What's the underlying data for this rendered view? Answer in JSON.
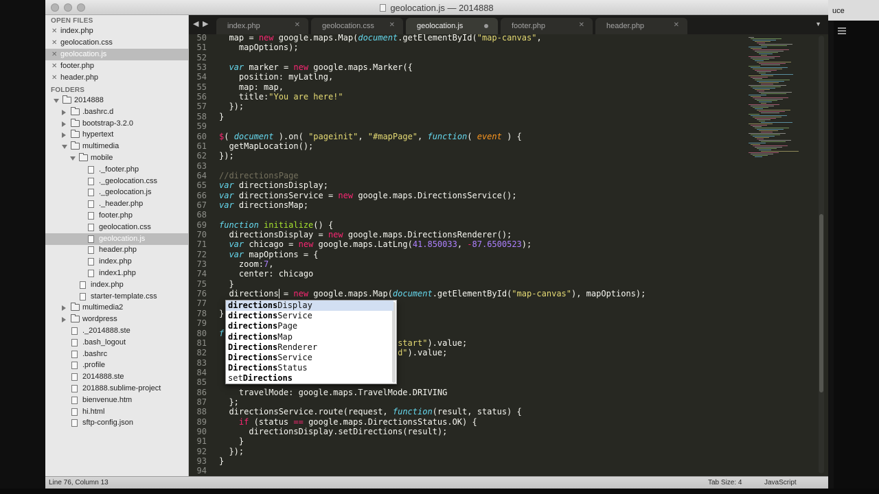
{
  "window": {
    "title": "geolocation.js — 2014888"
  },
  "backdrop": {
    "peek_text": "uce"
  },
  "sidebar": {
    "open_files_header": "OPEN FILES",
    "open_files": [
      {
        "name": "index.php",
        "selected": false
      },
      {
        "name": "geolocation.css",
        "selected": false
      },
      {
        "name": "geolocation.js",
        "selected": true
      },
      {
        "name": "footer.php",
        "selected": false
      },
      {
        "name": "header.php",
        "selected": false
      }
    ],
    "folders_header": "FOLDERS",
    "tree": [
      {
        "name": "2014888",
        "type": "folder",
        "expanded": true,
        "depth": 0
      },
      {
        "name": ".bashrc.d",
        "type": "folder",
        "expanded": false,
        "depth": 1
      },
      {
        "name": "bootstrap-3.2.0",
        "type": "folder",
        "expanded": false,
        "depth": 1
      },
      {
        "name": "hypertext",
        "type": "folder",
        "expanded": false,
        "depth": 1
      },
      {
        "name": "multimedia",
        "type": "folder",
        "expanded": true,
        "depth": 1
      },
      {
        "name": "mobile",
        "type": "folder",
        "expanded": true,
        "depth": 2
      },
      {
        "name": "._footer.php",
        "type": "file",
        "depth": 3
      },
      {
        "name": "._geolocation.css",
        "type": "file",
        "depth": 3
      },
      {
        "name": "._geolocation.js",
        "type": "file",
        "depth": 3
      },
      {
        "name": "._header.php",
        "type": "file",
        "depth": 3
      },
      {
        "name": "footer.php",
        "type": "file",
        "depth": 3
      },
      {
        "name": "geolocation.css",
        "type": "file",
        "depth": 3
      },
      {
        "name": "geolocation.js",
        "type": "file",
        "depth": 3,
        "selected": true
      },
      {
        "name": "header.php",
        "type": "file",
        "depth": 3
      },
      {
        "name": "index.php",
        "type": "file",
        "depth": 3
      },
      {
        "name": "index1.php",
        "type": "file",
        "depth": 3
      },
      {
        "name": "index.php",
        "type": "file",
        "depth": 2
      },
      {
        "name": "starter-template.css",
        "type": "file",
        "depth": 2
      },
      {
        "name": "multimedia2",
        "type": "folder",
        "expanded": false,
        "depth": 1
      },
      {
        "name": "wordpress",
        "type": "folder",
        "expanded": false,
        "depth": 1
      },
      {
        "name": "._2014888.ste",
        "type": "file",
        "depth": 1
      },
      {
        "name": ".bash_logout",
        "type": "file",
        "depth": 1
      },
      {
        "name": ".bashrc",
        "type": "file",
        "depth": 1
      },
      {
        "name": ".profile",
        "type": "file",
        "depth": 1
      },
      {
        "name": "2014888.ste",
        "type": "file",
        "depth": 1
      },
      {
        "name": "201888.sublime-project",
        "type": "file",
        "depth": 1
      },
      {
        "name": "bienvenue.htm",
        "type": "file",
        "depth": 1
      },
      {
        "name": "hi.html",
        "type": "file",
        "depth": 1
      },
      {
        "name": "sftp-config.json",
        "type": "file",
        "depth": 1
      }
    ]
  },
  "tabs": {
    "nav_left": "◀",
    "nav_right": "▶",
    "more": "▼",
    "items": [
      {
        "label": "index.php",
        "active": false,
        "dirty": false
      },
      {
        "label": "geolocation.css",
        "active": false,
        "dirty": false
      },
      {
        "label": "geolocation.js",
        "active": true,
        "dirty": true
      },
      {
        "label": "footer.php",
        "active": false,
        "dirty": false
      },
      {
        "label": "header.php",
        "active": false,
        "dirty": false
      }
    ],
    "close_glyph": "✕"
  },
  "editor": {
    "lines": [
      {
        "n": "50",
        "tokens": [
          [
            "  ",
            ""
          ],
          [
            "map",
            "cl"
          ],
          [
            " = ",
            ""
          ],
          [
            "new",
            "op"
          ],
          [
            " google.maps.Map(",
            ""
          ],
          [
            "document",
            "kw"
          ],
          [
            ".getElementById(",
            ""
          ],
          [
            "\"map-canvas\"",
            "st"
          ],
          [
            ",",
            ""
          ]
        ]
      },
      {
        "n": "51",
        "tokens": [
          [
            "    mapOptions);",
            ""
          ]
        ]
      },
      {
        "n": "52",
        "tokens": []
      },
      {
        "n": "53",
        "tokens": [
          [
            "  ",
            ""
          ],
          [
            "var",
            "kw"
          ],
          [
            " marker = ",
            ""
          ],
          [
            "new",
            "op"
          ],
          [
            " google.maps.Marker({",
            ""
          ]
        ]
      },
      {
        "n": "54",
        "tokens": [
          [
            "    position: myLatlng,",
            ""
          ]
        ]
      },
      {
        "n": "55",
        "tokens": [
          [
            "    map: map,",
            ""
          ]
        ]
      },
      {
        "n": "56",
        "tokens": [
          [
            "    title:",
            ""
          ],
          [
            "\"You are here!\"",
            "st"
          ]
        ]
      },
      {
        "n": "57",
        "tokens": [
          [
            "  });",
            ""
          ]
        ]
      },
      {
        "n": "58",
        "tokens": [
          [
            "}",
            ""
          ]
        ]
      },
      {
        "n": "59",
        "tokens": []
      },
      {
        "n": "60",
        "tokens": [
          [
            "$",
            "op"
          ],
          [
            "( ",
            ""
          ],
          [
            "document",
            "kw"
          ],
          [
            " ).on( ",
            ""
          ],
          [
            "\"pageinit\"",
            "st"
          ],
          [
            ", ",
            ""
          ],
          [
            "\"#mapPage\"",
            "st"
          ],
          [
            ", ",
            ""
          ],
          [
            "function",
            "kw"
          ],
          [
            "( ",
            ""
          ],
          [
            "event",
            "pa"
          ],
          [
            " ) {",
            ""
          ]
        ]
      },
      {
        "n": "61",
        "tokens": [
          [
            "  getMapLocation();",
            ""
          ]
        ]
      },
      {
        "n": "62",
        "tokens": [
          [
            "});",
            ""
          ]
        ]
      },
      {
        "n": "63",
        "tokens": []
      },
      {
        "n": "64",
        "tokens": [
          [
            "//directionsPage",
            "cm"
          ]
        ]
      },
      {
        "n": "65",
        "tokens": [
          [
            "var",
            "kw"
          ],
          [
            " directionsDisplay;",
            ""
          ]
        ]
      },
      {
        "n": "66",
        "tokens": [
          [
            "var",
            "kw"
          ],
          [
            " directionsService = ",
            ""
          ],
          [
            "new",
            "op"
          ],
          [
            " google.maps.DirectionsService();",
            ""
          ]
        ]
      },
      {
        "n": "67",
        "tokens": [
          [
            "var",
            "kw"
          ],
          [
            " directionsMap;",
            ""
          ]
        ]
      },
      {
        "n": "68",
        "tokens": []
      },
      {
        "n": "69",
        "tokens": [
          [
            "function",
            "kw"
          ],
          [
            " ",
            ""
          ],
          [
            "initialize",
            "fn"
          ],
          [
            "() {",
            ""
          ]
        ]
      },
      {
        "n": "70",
        "tokens": [
          [
            "  directionsDisplay = ",
            ""
          ],
          [
            "new",
            "op"
          ],
          [
            " google.maps.DirectionsRenderer();",
            ""
          ]
        ]
      },
      {
        "n": "71",
        "tokens": [
          [
            "  ",
            ""
          ],
          [
            "var",
            "kw"
          ],
          [
            " chicago = ",
            ""
          ],
          [
            "new",
            "op"
          ],
          [
            " google.maps.LatLng(",
            ""
          ],
          [
            "41.850033",
            "nu"
          ],
          [
            ", ",
            ""
          ],
          [
            "-",
            "op"
          ],
          [
            "87.6500523",
            "nu"
          ],
          [
            ");",
            ""
          ]
        ]
      },
      {
        "n": "72",
        "tokens": [
          [
            "  ",
            ""
          ],
          [
            "var",
            "kw"
          ],
          [
            " mapOptions = {",
            ""
          ]
        ]
      },
      {
        "n": "73",
        "tokens": [
          [
            "    zoom:",
            ""
          ],
          [
            "7",
            "nu"
          ],
          [
            ",",
            ""
          ]
        ]
      },
      {
        "n": "74",
        "tokens": [
          [
            "    center: chicago",
            ""
          ]
        ]
      },
      {
        "n": "75",
        "tokens": [
          [
            "  }",
            ""
          ]
        ]
      },
      {
        "n": "76",
        "tokens": [
          [
            "  directions",
            ""
          ],
          [
            " = ",
            ""
          ],
          [
            "new",
            "op"
          ],
          [
            " google.maps.Map(",
            ""
          ],
          [
            "document",
            "kw"
          ],
          [
            ".getElementById(",
            ""
          ],
          [
            "\"map-canvas\"",
            "st"
          ],
          [
            "), mapOptions);",
            ""
          ]
        ]
      },
      {
        "n": "77",
        "tokens": []
      },
      {
        "n": "78",
        "tokens": [
          [
            "}",
            ""
          ]
        ]
      },
      {
        "n": "79",
        "tokens": []
      },
      {
        "n": "80",
        "tokens": [
          [
            "f",
            "kw"
          ]
        ]
      },
      {
        "n": "81",
        "tokens": [
          [
            "                                    start\"",
            "st"
          ],
          [
            ").value;",
            ""
          ]
        ]
      },
      {
        "n": "82",
        "tokens": [
          [
            "                                    d\"",
            "st"
          ],
          [
            ").value;",
            ""
          ]
        ]
      },
      {
        "n": "83",
        "tokens": []
      },
      {
        "n": "84",
        "tokens": []
      },
      {
        "n": "85",
        "tokens": []
      },
      {
        "n": "86",
        "tokens": [
          [
            "    travelMode: google.maps.TravelMode.DRIVING",
            ""
          ]
        ]
      },
      {
        "n": "87",
        "tokens": [
          [
            "  };",
            ""
          ]
        ]
      },
      {
        "n": "88",
        "tokens": [
          [
            "  directionsService.route(request, ",
            ""
          ],
          [
            "function",
            "kw"
          ],
          [
            "(result, status) {",
            ""
          ]
        ]
      },
      {
        "n": "89",
        "tokens": [
          [
            "    ",
            ""
          ],
          [
            "if",
            "op"
          ],
          [
            " (status ",
            ""
          ],
          [
            "==",
            "op"
          ],
          [
            " google.maps.DirectionsStatus.OK) {",
            ""
          ]
        ]
      },
      {
        "n": "90",
        "tokens": [
          [
            "      directionsDisplay.setDirections(result);",
            ""
          ]
        ]
      },
      {
        "n": "91",
        "tokens": [
          [
            "    }",
            ""
          ]
        ]
      },
      {
        "n": "92",
        "tokens": [
          [
            "  });",
            ""
          ]
        ]
      },
      {
        "n": "93",
        "tokens": [
          [
            "}",
            ""
          ]
        ]
      },
      {
        "n": "94",
        "tokens": []
      }
    ]
  },
  "autocomplete": {
    "items": [
      {
        "match": "directions",
        "rest": "Display",
        "selected": true
      },
      {
        "match": "directions",
        "rest": "Service",
        "selected": false
      },
      {
        "match": "directions",
        "rest": "Page",
        "selected": false
      },
      {
        "match": "directions",
        "rest": "Map",
        "selected": false
      },
      {
        "match": "Directions",
        "rest": "Renderer",
        "selected": false
      },
      {
        "match": "Directions",
        "rest": "Service",
        "selected": false
      },
      {
        "match": "Directions",
        "rest": "Status",
        "selected": false
      },
      {
        "prefix": "set",
        "match": "Directions",
        "rest": "",
        "selected": false
      }
    ]
  },
  "statusbar": {
    "position": "Line 76, Column 13",
    "tab_size": "Tab Size: 4",
    "syntax": "JavaScript"
  },
  "colors": {
    "editor_bg": "#272822",
    "keyword": "#66d9ef",
    "string": "#e6db74",
    "number": "#ae81ff",
    "operator": "#f92672",
    "function": "#a6e22e",
    "comment": "#75715e",
    "sidebar_bg": "#e8e8e8"
  },
  "icons": {
    "close": "close-icon",
    "folder": "folder-icon",
    "file": "file-icon",
    "disclosure": "disclosure-arrow-icon",
    "dirty": "unsaved-dot-icon",
    "menu": "hamburger-menu-icon"
  }
}
